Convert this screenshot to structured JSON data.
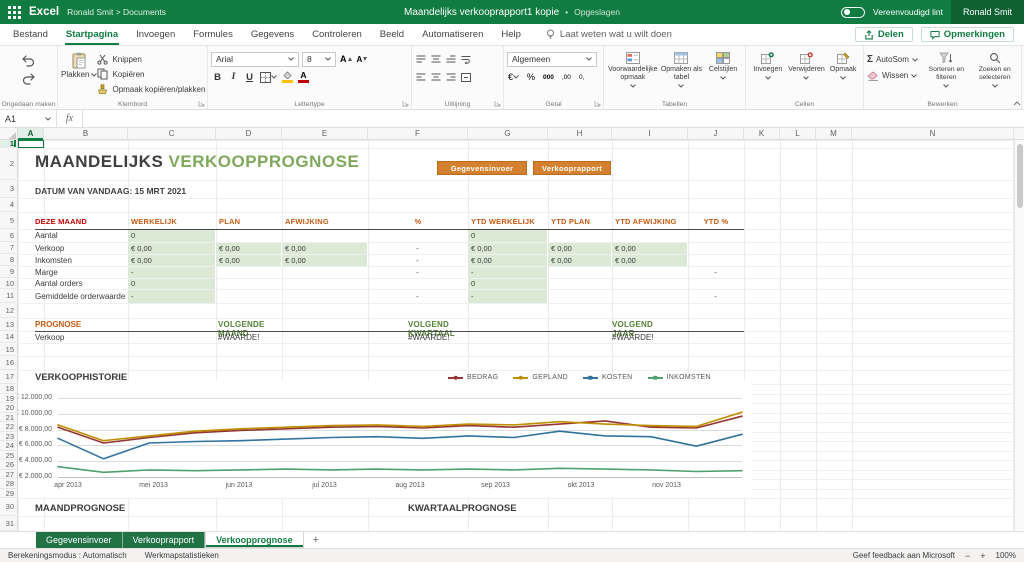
{
  "theme": {
    "titlebar_green": "#107C41",
    "accent_green": "#107C41",
    "tab_green": "#217346",
    "button_orange": "#D3812F",
    "button_orange_border": "#B96A1F",
    "header_orange": "#C55A11",
    "header_red": "#C00000",
    "cell_green_fill": "#DCE9D5",
    "title_accent_green": "#7FA85C",
    "section_green": "#538135"
  },
  "titlebar": {
    "app_name": "Excel",
    "breadcrumb": "Ronald Smit  >  Documents",
    "doc_title": "Maandelijks verkooprapport1 kopie",
    "separator": "•",
    "saved_status": "Opgeslagen",
    "ribbon_toggle_label": "Vereenvoudigd lint",
    "user_name": "Ronald Smit"
  },
  "menubar": {
    "tabs": [
      "Bestand",
      "Startpagina",
      "Invoegen",
      "Formules",
      "Gegevens",
      "Controleren",
      "Beeld",
      "Automatiseren",
      "Help"
    ],
    "active_tab": "Startpagina",
    "tell_me": "Laat weten wat u wilt doen",
    "share_label": "Delen",
    "comments_label": "Opmerkingen"
  },
  "ribbon": {
    "undo_group_label": "Ongedaan maken",
    "clipboard": {
      "label": "Klembord",
      "paste": "Plakken",
      "cut": "Knippen",
      "copy": "Kopiëren",
      "format_painter": "Opmaak kopiëren/plakken"
    },
    "font": {
      "label": "Lettertype",
      "family": "Arial",
      "size": "8"
    },
    "alignment": {
      "label": "Uitlijning"
    },
    "number": {
      "label": "Getal",
      "format": "Algemeen",
      "icons": [
        "€",
        "%",
        "000",
        ",00",
        "0,"
      ]
    },
    "tables": {
      "label": "Tabellen",
      "items": [
        "Voorwaardelijke opmaak",
        "Opmaken als tabel",
        "Celstijlen"
      ]
    },
    "cells": {
      "label": "Cellen",
      "items": [
        "Invoegen",
        "Verwijderen",
        "Opmaak"
      ]
    },
    "editing": {
      "label": "Bewerken",
      "autosum": "AutoSom",
      "clear": "Wissen",
      "sort": "Sorteren en filteren",
      "find": "Zoeken en selecteren"
    }
  },
  "formula_bar": {
    "cell_ref": "A1",
    "fx": "fx",
    "value": ""
  },
  "grid": {
    "col_letters": [
      "A",
      "B",
      "C",
      "D",
      "E",
      "F",
      "G",
      "H",
      "I",
      "J",
      "K",
      "L",
      "M",
      "N"
    ],
    "row_count": 31
  },
  "sheet": {
    "title": {
      "main": "MAANDELIJKS",
      "accent": "VERKOOPPROGNOSE"
    },
    "action_buttons": [
      "Gegevensinvoer",
      "Verkooprapport"
    ],
    "date_label": "DATUM VAN VANDAAG: 15 MRT 2021",
    "month_table": {
      "headers": [
        {
          "key": "label",
          "text": "DEZE MAAND"
        },
        {
          "key": "c",
          "text": "WERKELIJK"
        },
        {
          "key": "d",
          "text": "PLAN"
        },
        {
          "key": "e",
          "text": "AFWIJKING"
        },
        {
          "key": "f",
          "text": "%"
        },
        {
          "key": "g",
          "text": "YTD WERKELIJK"
        },
        {
          "key": "h",
          "text": "YTD PLAN"
        },
        {
          "key": "i",
          "text": "YTD AFWIJKING"
        },
        {
          "key": "j",
          "text": "YTD %"
        }
      ],
      "rows": [
        {
          "label": "Aantal",
          "cells": [
            {
              "col": "c",
              "text": "0",
              "fill": true
            },
            {
              "col": "g",
              "text": "0",
              "fill": true
            }
          ]
        },
        {
          "label": "Verkoop",
          "cells": [
            {
              "col": "c",
              "text": "€ 0,00",
              "fill": true
            },
            {
              "col": "d",
              "text": "€ 0,00",
              "fill": true
            },
            {
              "col": "e",
              "text": "€ 0,00",
              "fill": true
            },
            {
              "col": "f",
              "text": "-",
              "fill": false
            },
            {
              "col": "g",
              "text": "€ 0,00",
              "fill": true
            },
            {
              "col": "h",
              "text": "€ 0,00",
              "fill": true
            },
            {
              "col": "i",
              "text": "€ 0,00",
              "fill": true
            }
          ]
        },
        {
          "label": "Inkomsten",
          "cells": [
            {
              "col": "c",
              "text": "€ 0,00",
              "fill": true
            },
            {
              "col": "d",
              "text": "€ 0,00",
              "fill": true
            },
            {
              "col": "e",
              "text": "€ 0,00",
              "fill": true
            },
            {
              "col": "f",
              "text": "-",
              "fill": false
            },
            {
              "col": "g",
              "text": "€ 0,00",
              "fill": true
            },
            {
              "col": "h",
              "text": "€ 0,00",
              "fill": true
            },
            {
              "col": "i",
              "text": "€ 0,00",
              "fill": true
            }
          ]
        },
        {
          "label": "Marge",
          "cells": [
            {
              "col": "c",
              "text": "-",
              "fill": true
            },
            {
              "col": "f",
              "text": "-",
              "fill": false
            },
            {
              "col": "g",
              "text": "-",
              "fill": true
            },
            {
              "col": "j",
              "text": "-",
              "fill": false
            }
          ]
        },
        {
          "label": "Aantal orders",
          "cells": [
            {
              "col": "c",
              "text": "0",
              "fill": true
            },
            {
              "col": "g",
              "text": "0",
              "fill": true
            }
          ]
        },
        {
          "label": "Gemiddelde orderwaarde",
          "cells": [
            {
              "col": "c",
              "text": "-",
              "fill": true
            },
            {
              "col": "f",
              "text": "-",
              "fill": false
            },
            {
              "col": "g",
              "text": "-",
              "fill": true
            },
            {
              "col": "j",
              "text": "-",
              "fill": false
            }
          ]
        }
      ]
    },
    "prognose": {
      "label": "PROGNOSE",
      "columns": [
        "VOLGENDE MAAND",
        "VOLGEND KWARTAAL",
        "VOLGEND JAAR"
      ],
      "row_label": "Verkoop",
      "values": [
        "#WAARDE!",
        "#WAARDE!",
        "#WAARDE!"
      ]
    },
    "history_title": "VERKOOPHISTORIE",
    "footer": {
      "left": "MAANDPROGNOSE",
      "right": "KWARTAALPROGNOSE"
    }
  },
  "chart_data": {
    "type": "line",
    "title": "VERKOOPHISTORIE",
    "x_tick_labels": [
      "apr 2013",
      "mei 2013",
      "jun 2013",
      "jul 2013",
      "aug 2013",
      "sep 2013",
      "okt 2013",
      "nov 2013"
    ],
    "y_tick_labels": [
      "€ 12.000,00",
      "€ 10.000,00",
      "€ 8.000,00",
      "€ 6.000,00",
      "€ 4.000,00",
      "€ 2.000,00"
    ],
    "ylim": [
      2000,
      12000
    ],
    "grid": true,
    "legend_position": "top-right",
    "series": [
      {
        "name": "BEDRAG",
        "color": "#963634",
        "values": [
          8300,
          6300,
          7000,
          7600,
          7900,
          8100,
          8300,
          8400,
          8200,
          8500,
          8300,
          8700,
          9100,
          8300,
          8200,
          9700
        ]
      },
      {
        "name": "GEPLAND",
        "color": "#BF8F00",
        "values": [
          8600,
          6600,
          7200,
          7800,
          8100,
          8300,
          8500,
          8600,
          8400,
          8700,
          8600,
          9000,
          8700,
          8500,
          8400,
          10200
        ]
      },
      {
        "name": "KOSTEN",
        "color": "#31739C",
        "values": [
          6900,
          4300,
          6300,
          6500,
          6600,
          6800,
          7000,
          7100,
          6900,
          7200,
          7000,
          7800,
          7200,
          7100,
          5900,
          7400
        ]
      },
      {
        "name": "INKOMSTEN",
        "color": "#4FA06F",
        "values": [
          3300,
          2600,
          2900,
          2800,
          2900,
          3000,
          2900,
          3000,
          2900,
          3000,
          2900,
          3100,
          3000,
          2900,
          2700,
          2800
        ]
      }
    ]
  },
  "sheet_tabs": {
    "items": [
      {
        "label": "Gegevensinvoer",
        "active": false
      },
      {
        "label": "Verkooprapport",
        "active": false
      },
      {
        "label": "Verkoopprognose",
        "active": true
      }
    ],
    "add_label": "+"
  },
  "statusbar": {
    "left_items": [
      "Berekeningsmodus : Automatisch",
      "Werkmapstatistieken"
    ],
    "feedback": "Geef feedback aan Microsoft",
    "zoom_out": "−",
    "zoom_in": "+",
    "zoom": "100%"
  }
}
